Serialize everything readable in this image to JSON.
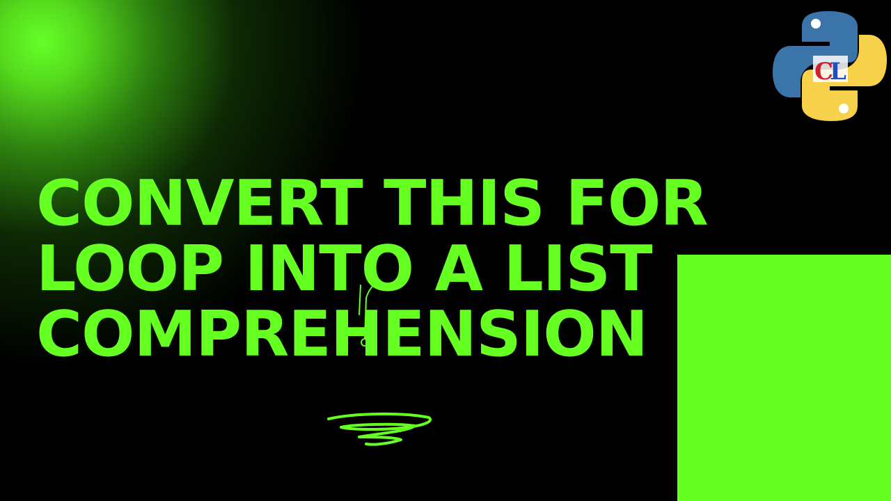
{
  "headline": {
    "line1": "CONVERT THIS FOR",
    "line2": "LOOP INTO A LIST",
    "line3": "COMPREHENSION"
  },
  "logo": {
    "icon": "python-logo-icon",
    "monogram": "CL"
  },
  "decorations": {
    "squiggle": "scribble-icon",
    "hook": "hook-arrow-icon"
  },
  "colors": {
    "background": "#000000",
    "accent_green": "#66ff22",
    "python_blue": "#3b74a8",
    "python_yellow": "#f7d14a"
  }
}
